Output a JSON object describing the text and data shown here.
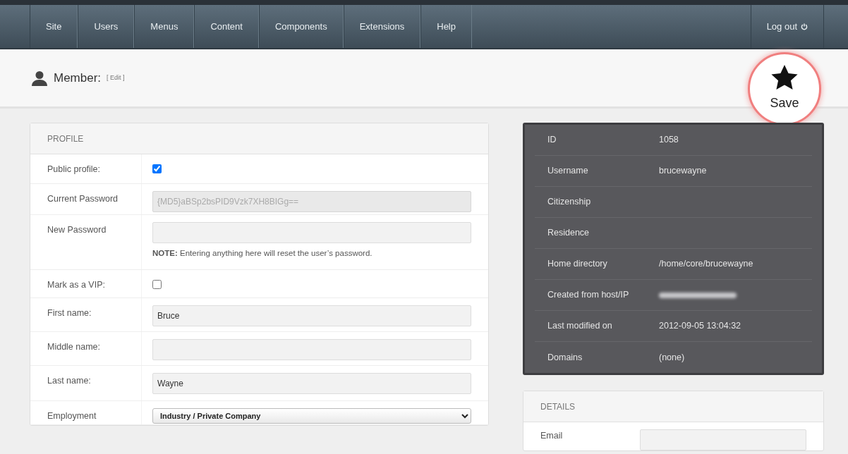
{
  "nav": {
    "items": [
      {
        "label": "Site"
      },
      {
        "label": "Users"
      },
      {
        "label": "Menus"
      },
      {
        "label": "Content"
      },
      {
        "label": "Components"
      },
      {
        "label": "Extensions"
      },
      {
        "label": "Help"
      }
    ],
    "logout": "Log out"
  },
  "header": {
    "title": "Member:",
    "edit_link": "[ Edit ]",
    "save_button": "Save"
  },
  "profile": {
    "title": "PROFILE",
    "fields": [
      {
        "kind": "checkbox",
        "label": "Public profile:",
        "checked": true
      },
      {
        "kind": "readonly",
        "label": "Current Password",
        "value": "{MD5}aBSp2bsPID9Vzk7XH8BIGg=="
      },
      {
        "kind": "text",
        "label": "New Password",
        "note": "**NOTE:** Entering anything here will reset the user’s password."
      },
      {
        "kind": "checkbox",
        "label": "Mark as a VIP:",
        "checked": false
      },
      {
        "kind": "text",
        "label": "First name:",
        "value": "Bruce"
      },
      {
        "kind": "text",
        "label": "Middle name:"
      },
      {
        "kind": "text",
        "label": "Last name:",
        "value": "Wayne"
      },
      {
        "kind": "select",
        "label": "Employment",
        "value": "Industry / Private Company"
      }
    ]
  },
  "info": {
    "rows": [
      {
        "kind": "text",
        "label": "ID",
        "value": "1058"
      },
      {
        "kind": "text",
        "label": "Username",
        "value": "brucewayne"
      },
      {
        "kind": "text",
        "label": "Citizenship"
      },
      {
        "kind": "text",
        "label": "Residence"
      },
      {
        "kind": "text",
        "label": "Home directory",
        "value": "/home/core/brucewayne"
      },
      {
        "kind": "redacted",
        "label": "Created from host/IP"
      },
      {
        "kind": "text",
        "label": "Last modified on",
        "value": "2012-09-05 13:04:32"
      },
      {
        "kind": "text",
        "label": "Domains",
        "value": "(none)"
      }
    ]
  },
  "details": {
    "title": "DETAILS",
    "fields": [
      {
        "label": "Email"
      }
    ]
  }
}
